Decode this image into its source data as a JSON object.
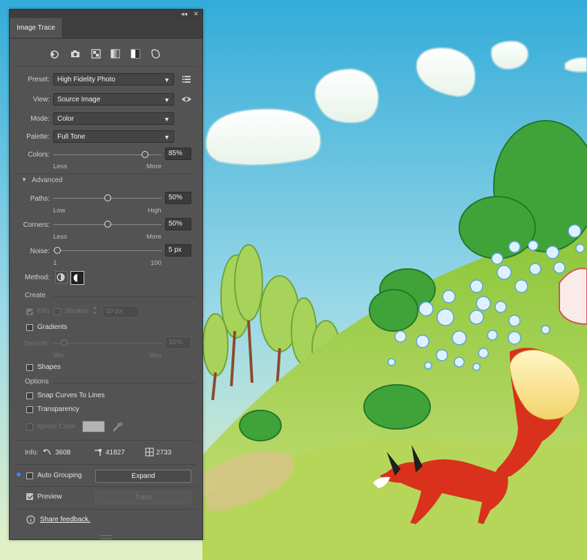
{
  "panel": {
    "tab_title": "Image Trace",
    "collapse_glyph": "◂◂",
    "close_glyph": "✕",
    "top_icons": [
      "auto-color-icon",
      "high-color-photo-icon",
      "low-color-icon",
      "grayscale-icon",
      "black-and-white-icon",
      "outline-icon"
    ],
    "preset": {
      "label": "Preset:",
      "value": "High Fidelity Photo"
    },
    "view": {
      "label": "View:",
      "value": "Source Image"
    },
    "mode": {
      "label": "Mode:",
      "value": "Color"
    },
    "palette": {
      "label": "Palette:",
      "value": "Full Tone"
    },
    "colors": {
      "label": "Colors:",
      "value": "85%",
      "level": 0.85,
      "min_label": "Less",
      "max_label": "More"
    },
    "advanced": {
      "label": "Advanced",
      "expanded": true
    },
    "paths": {
      "label": "Paths:",
      "value": "50%",
      "level": 0.5,
      "min_label": "Low",
      "max_label": "High"
    },
    "corners": {
      "label": "Corners:",
      "value": "50%",
      "level": 0.5,
      "min_label": "Less",
      "max_label": "More"
    },
    "noise": {
      "label": "Noise:",
      "value": "5 px",
      "level": 0.04,
      "min_label": "1",
      "max_label": "100"
    },
    "method": {
      "label": "Method:",
      "options": [
        "abutting",
        "overlapping"
      ],
      "selected": "overlapping"
    },
    "create": {
      "label": "Create",
      "fills": {
        "label": "Fills",
        "checked": true,
        "enabled": false
      },
      "strokes": {
        "label": "Strokes",
        "checked": false,
        "enabled": false
      },
      "stroke_value": "10 px",
      "gradients": {
        "label": "Gradients",
        "checked": false
      },
      "smooth": {
        "label": "Smooth:",
        "value": "10%",
        "level": 0.1,
        "min_label": "Min",
        "max_label": "Max",
        "enabled": false
      },
      "shapes": {
        "label": "Shapes",
        "checked": false
      }
    },
    "options": {
      "label": "Options",
      "snap": {
        "label": "Snap Curves To Lines",
        "checked": false
      },
      "transparency": {
        "label": "Transparency",
        "checked": false
      },
      "ignore_color": {
        "label": "Ignore Color",
        "checked": false,
        "enabled": false,
        "swatch": "#b3b3b3"
      }
    },
    "info": {
      "label": "Info:",
      "paths": "3608",
      "anchors": "41827",
      "colors": "2733"
    },
    "auto_grouping": {
      "label": "Auto Grouping",
      "checked": false
    },
    "expand_label": "Expand",
    "preview": {
      "label": "Preview",
      "checked": true
    },
    "trace_label": "Trace",
    "feedback_label": "Share feedback."
  },
  "colors": {
    "sky": "#43b4dd",
    "panel_bg": "#535353",
    "hill": "#a7cf4a",
    "fox": "#d9311c"
  }
}
